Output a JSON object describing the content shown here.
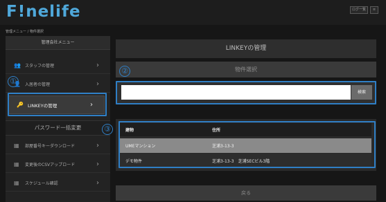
{
  "header": {
    "logo": "F!nelife",
    "btn1": "ログ一覧",
    "btn2": "≡"
  },
  "breadcrumb": "管理メニュー / 物件選択",
  "sidebar": {
    "heading": "管理会社メニュー",
    "items": [
      {
        "icon": "users-icon",
        "glyph": "👥",
        "label": "スタッフの管理"
      },
      {
        "icon": "resident-icon",
        "glyph": "👤",
        "label": "入居者の管理"
      },
      {
        "icon": "key-icon",
        "glyph": "🔑",
        "label": "LINKEYの管理"
      }
    ],
    "section": "パスワード一括変更",
    "items2": [
      {
        "icon": "download-icon",
        "glyph": "▦",
        "label": "部屋番号キーダウンロード"
      },
      {
        "icon": "upload-icon",
        "glyph": "▦",
        "label": "変更後のCSVアップロード"
      },
      {
        "icon": "calendar-icon",
        "glyph": "▦",
        "label": "スケジュール確認"
      }
    ]
  },
  "callouts": [
    "①",
    "②",
    "③"
  ],
  "main": {
    "title": "LINKEYの管理",
    "subtitle": "物件選択",
    "search": {
      "placeholder": "",
      "button": "検索"
    },
    "table": {
      "headers": [
        "建物",
        "住所"
      ],
      "rows": [
        [
          "UMEマンション",
          "芝浦3-13-3"
        ],
        [
          "デモ物件",
          "芝浦3-13-3　芝浦SECビル3階"
        ]
      ]
    },
    "back": "戻る"
  },
  "colors": {
    "accent": "#2f7fc6",
    "logo": "#4fa8da"
  }
}
